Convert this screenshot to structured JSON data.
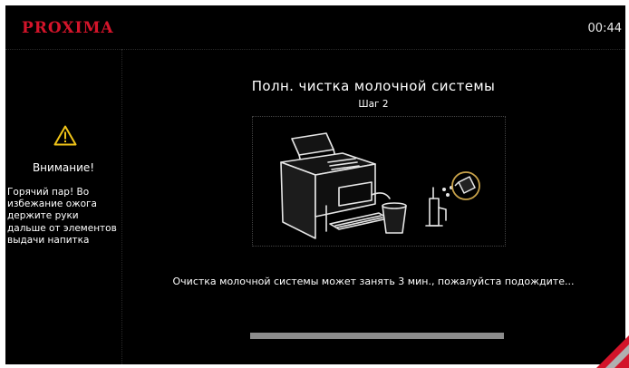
{
  "header": {
    "brand": "PROXIMA",
    "time": "00:44"
  },
  "warning": {
    "icon": "warning-triangle-icon",
    "title": "Внимание!",
    "text": "Горячий пар! Во избежание ожога держите руки дальше от элементов выдачи напитка"
  },
  "main": {
    "title": "Полн. чистка молочной системы",
    "step": "Шаг 2",
    "illustration": "coffee-machine-milk-cleaning-illustration",
    "message": "Очистка молочной системы может занять 3 мин., пожалуйста подождите...",
    "progress": 1.0
  },
  "colors": {
    "background": "#000000",
    "brand": "#d3142a",
    "text": "#ffffff",
    "progress": "#8c8c8c",
    "accent_gold": "#c8a24a"
  }
}
